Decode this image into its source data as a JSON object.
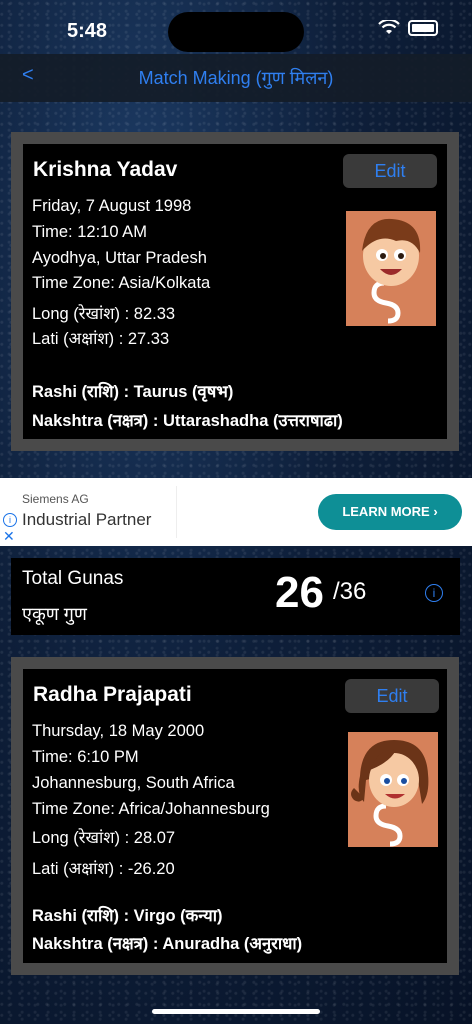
{
  "status": {
    "time": "5:48"
  },
  "nav": {
    "back": "<",
    "title": "Match Making (गुण मिलन)"
  },
  "profile1": {
    "name": "Krishna Yadav",
    "edit": "Edit",
    "date": "Friday, 7 August 1998",
    "time": "Time: 12:10 AM",
    "place": "Ayodhya, Uttar Pradesh",
    "timezone": "Time Zone: Asia/Kolkata",
    "long": "Long (रेखांश) : 82.33",
    "lati": "Lati (अक्षांश) : 27.33",
    "rashi": "Rashi (राशि) : Taurus (वृषभ)",
    "nakshtra": "Nakshtra (नक्षत्र) : Uttarashadha (उत्तराषाढा)"
  },
  "ad": {
    "sponsor": "Siemens AG",
    "headline": "Industrial Partner",
    "cta": "LEARN MORE"
  },
  "gunas": {
    "label": "Total Gunas",
    "label_hi": "एकूण गुण",
    "score": "26",
    "total": "/36"
  },
  "profile2": {
    "name": "Radha Prajapati",
    "edit": "Edit",
    "date": "Thursday, 18 May 2000",
    "time": "Time: 6:10 PM",
    "place": "Johannesburg, South Africa",
    "timezone": "Time Zone: Africa/Johannesburg",
    "long": "Long (रेखांश) :  28.07",
    "lati": "Lati (अक्षांश) : -26.20",
    "rashi": "Rashi (राशि) : Virgo (कन्या)",
    "nakshtra": "Nakshtra (नक्षत्र) : Anuradha (अनुराधा)"
  },
  "colors": {
    "accent": "#2f7ff0",
    "ad_cta": "#0e8f96"
  }
}
